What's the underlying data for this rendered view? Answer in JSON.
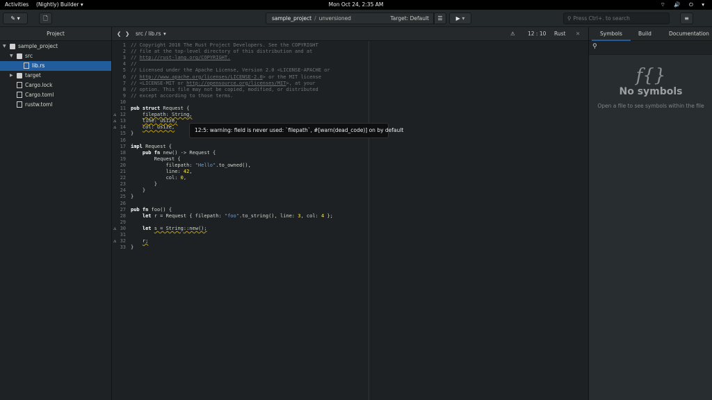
{
  "topbar": {
    "activities": "Activities",
    "app_menu": "(Nightly) Builder ▾",
    "clock": "Mon Oct 24,  2:35 AM",
    "system_icons": "⌔ 🔊 ⏻ ▾"
  },
  "header": {
    "project_name": "sample_project",
    "separator": "/",
    "vcs_status": "unversioned",
    "target": "Target: Default",
    "search_placeholder": "Press Ctrl+. to search"
  },
  "project_panel": {
    "title": "Project",
    "tree": [
      {
        "label": "sample_project",
        "type": "folder",
        "depth": 0,
        "expanded": true,
        "selected": false
      },
      {
        "label": "src",
        "type": "folder",
        "depth": 1,
        "expanded": true,
        "selected": false
      },
      {
        "label": "lib.rs",
        "type": "file",
        "depth": 2,
        "expanded": false,
        "selected": true
      },
      {
        "label": "target",
        "type": "folder",
        "depth": 1,
        "expanded": false,
        "selected": false
      },
      {
        "label": "Cargo.lock",
        "type": "file",
        "depth": 1,
        "expanded": false,
        "selected": false
      },
      {
        "label": "Cargo.toml",
        "type": "file",
        "depth": 1,
        "expanded": false,
        "selected": false
      },
      {
        "label": "rustw.toml",
        "type": "file",
        "depth": 1,
        "expanded": false,
        "selected": false
      }
    ]
  },
  "editor": {
    "path": "src / lib.rs",
    "cursor": "12 : 10",
    "language": "Rust",
    "warning_tooltip": "12:5: warning: field is never used: `filepath`, #[warn(dead_code)] on by default",
    "warning_lines": [
      12,
      13,
      14,
      30,
      32
    ],
    "lines": [
      "// Copyright 2016 The Rust Project Developers. See the COPYRIGHT",
      "// file at the top-level directory of this distribution and at",
      "// http://rust-lang.org/COPYRIGHT.",
      "//",
      "// Licensed under the Apache License, Version 2.0 <LICENSE-APACHE or",
      "// http://www.apache.org/licenses/LICENSE-2.0> or the MIT license",
      "// <LICENSE-MIT or http://opensource.org/licenses/MIT>, at your",
      "// option. This file may not be copied, modified, or distributed",
      "// except according to those terms.",
      "",
      "pub struct Request {",
      "    filepath: String,",
      "    line: usize,",
      "    col: usize,",
      "}",
      "",
      "impl Request {",
      "    pub fn new() -> Request {",
      "        Request {",
      "            filepath: \"Hello\".to_owned(),",
      "            line: 42,",
      "            col: 0,",
      "        }",
      "    }",
      "}",
      "",
      "pub fn foo() {",
      "    let r = Request { filepath: \"foo\".to_string(), line: 3, col: 4 };",
      "",
      "    let s = String::new();",
      "",
      "    r;",
      "}"
    ]
  },
  "right_panel": {
    "tabs": [
      "Symbols",
      "Build",
      "Documentation"
    ],
    "active_tab": "Symbols",
    "empty_icon": "f{}",
    "empty_title": "No symbols",
    "empty_subtitle": "Open a file to see symbols within the file"
  },
  "colors": {
    "selection": "#215d9c",
    "string": "#729fcf",
    "number": "#fce94f",
    "comment": "#6f7576",
    "warning_underline": "#c4a000"
  },
  "icons": {
    "new_file_menu": "pencil-icon",
    "new_document": "document-icon",
    "build_settings": "build-settings-icon",
    "run": "play-icon",
    "run_menu": "chevron-down-icon",
    "main_menu": "hamburger-icon",
    "search": "search-icon",
    "warning": "warning-icon",
    "close": "close-icon"
  }
}
